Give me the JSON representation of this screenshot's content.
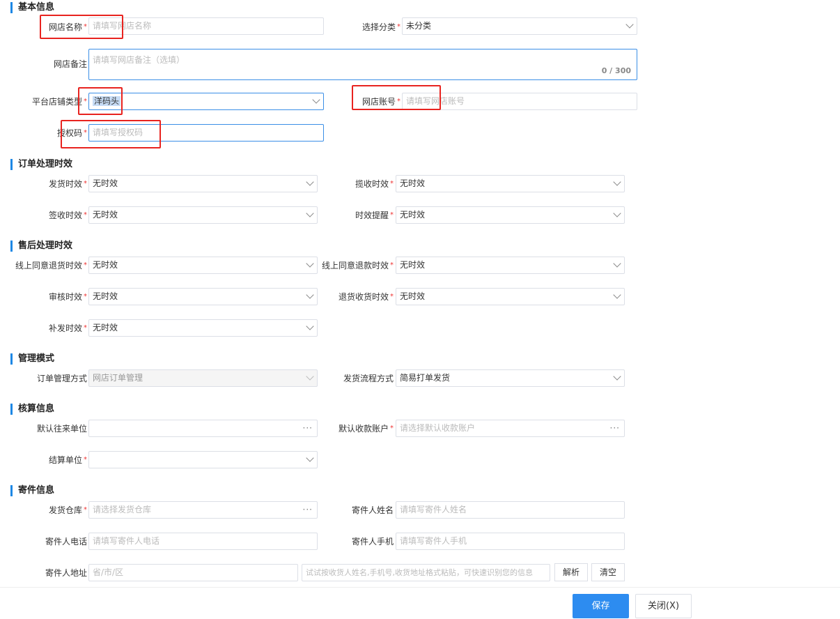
{
  "sections": {
    "basic": "基本信息",
    "order_timing": "订单处理时效",
    "aftersale_timing": "售后处理时效",
    "manage_mode": "管理模式",
    "accounting": "核算信息",
    "sender": "寄件信息"
  },
  "basic": {
    "shop_name_label": "网店名称",
    "shop_name_placeholder": "请填写网店名称",
    "category_label": "选择分类",
    "category_value": "未分类",
    "remark_label": "网店备注",
    "remark_placeholder": "请填写网店备注（选填）",
    "remark_counter": "0 / 300",
    "platform_type_label": "平台店铺类型",
    "platform_type_value": "洋码头",
    "account_label": "网店账号",
    "account_placeholder": "请填写网店账号",
    "auth_code_label": "授权码",
    "auth_code_placeholder": "请填写授权码"
  },
  "order_timing": {
    "ship_label": "发货时效",
    "ship_value": "无时效",
    "collect_label": "揽收时效",
    "collect_value": "无时效",
    "sign_label": "签收时效",
    "sign_value": "无时效",
    "remind_label": "时效提醒",
    "remind_value": "无时效"
  },
  "aftersale_timing": {
    "return_agree_label": "线上同意退货时效",
    "return_agree_value": "无时效",
    "refund_agree_label": "线上同意退款时效",
    "refund_agree_value": "无时效",
    "audit_label": "审核时效",
    "audit_value": "无时效",
    "return_receive_label": "退货收货时效",
    "return_receive_value": "无时效",
    "reship_label": "补发时效",
    "reship_value": "无时效"
  },
  "manage_mode": {
    "order_manage_label": "订单管理方式",
    "order_manage_value": "网店订单管理",
    "ship_flow_label": "发货流程方式",
    "ship_flow_value": "简易打单发货"
  },
  "accounting": {
    "default_partner_label": "默认往来单位",
    "default_account_label": "默认收款账户",
    "default_account_placeholder": "请选择默认收款账户",
    "settle_unit_label": "结算单位",
    "more_glyph": "···"
  },
  "sender": {
    "warehouse_label": "发货仓库",
    "warehouse_placeholder": "请选择发货仓库",
    "name_label": "寄件人姓名",
    "name_placeholder": "请填写寄件人姓名",
    "phone_label": "寄件人电话",
    "phone_placeholder": "请填写寄件人电话",
    "mobile_label": "寄件人手机",
    "mobile_placeholder": "请填写寄件人手机",
    "address_label": "寄件人地址",
    "region_placeholder": "省/市/区",
    "paste_placeholder": "试试按收货人姓名,手机号,收货地址格式粘贴，可快速识别您的信息",
    "parse_button": "解析",
    "clear_button": "清空"
  },
  "footer": {
    "save_button": "保存",
    "close_button": "关闭(X)"
  },
  "required_mark": "*",
  "colors": {
    "accent": "#1e88e5",
    "primary_button": "#2d8cf0",
    "required": "#e33333",
    "highlight_box": "#e8231f"
  }
}
